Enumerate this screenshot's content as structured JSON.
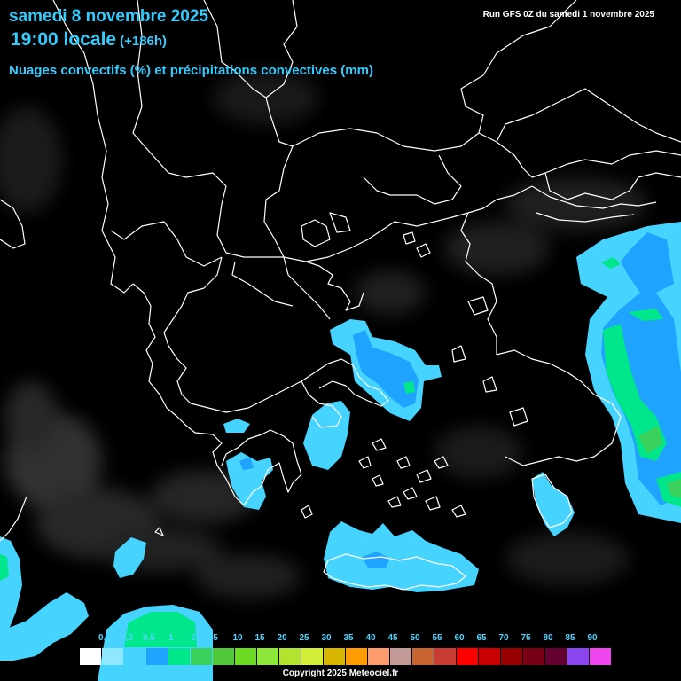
{
  "header": {
    "date": "samedi 8 novembre 2025",
    "time": "19:00 locale",
    "lead": "(+186h)",
    "subtitle": "Nuages convectifs (%) et précipitations convectives (mm)",
    "run_info": "Run GFS 0Z du samedi 1 novembre 2025"
  },
  "legend": {
    "labels": [
      "0,1",
      "0,2",
      "0,5",
      "1",
      "2",
      "5",
      "10",
      "15",
      "20",
      "25",
      "30",
      "35",
      "40",
      "45",
      "50",
      "55",
      "60",
      "65",
      "70",
      "75",
      "80",
      "85",
      "90"
    ],
    "colors": [
      "#ffffff",
      "#8fe8ff",
      "#46d4ff",
      "#1fa3ff",
      "#00e68a",
      "#39d15c",
      "#52c83d",
      "#6cdc23",
      "#8ee83c",
      "#b2e32e",
      "#d2ee3a",
      "#d8b600",
      "#ff9c00",
      "#ff9c6e",
      "#c49a96",
      "#c86432",
      "#c83c32",
      "#ff0000",
      "#c80000",
      "#960000",
      "#780014",
      "#640032",
      "#8c46f0",
      "#f046f0"
    ]
  },
  "footer": {
    "copyright": "Copyright 2025 Meteociel.fr"
  },
  "colors": {
    "title": "#33ccff",
    "light_precip": "#46d4ff",
    "moderate_precip": "#1fa3ff",
    "heavy_precip": "#00e68a",
    "strong_precip": "#39d15c",
    "borders": "#ffffff"
  }
}
